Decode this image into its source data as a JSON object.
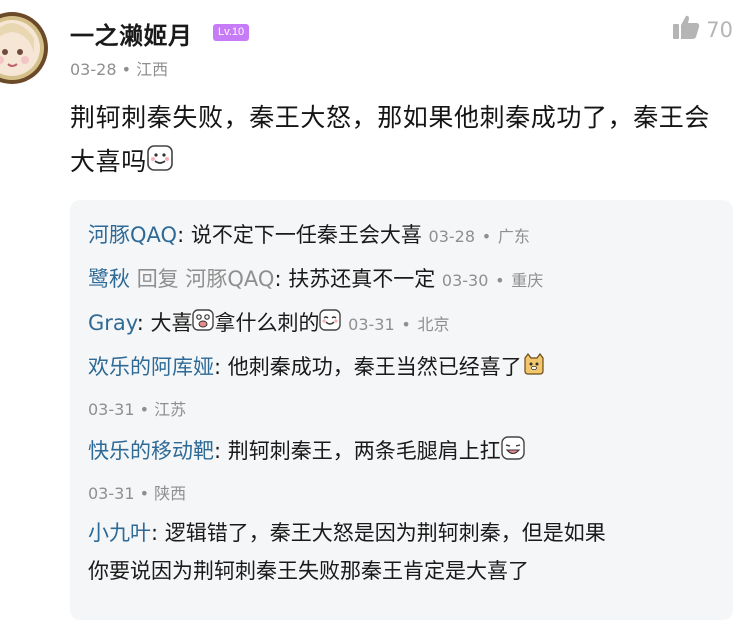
{
  "comment": {
    "username": "一之濑姬月",
    "level": "Lv.10",
    "like_count": "70",
    "date": "03-28",
    "location": "江西",
    "text": "荆轲刺秦失败，秦王大怒，那如果他刺秦成功了，秦王会大喜吗"
  },
  "replies": [
    {
      "name": "河豚QAQ",
      "text": "说不定下一任秦王会大喜",
      "date": "03-28",
      "location": "广东"
    },
    {
      "name": "鹭秋",
      "reply_word": "回复",
      "reply_to": "河豚QAQ",
      "text": "扶苏还真不一定",
      "date": "03-30",
      "location": "重庆"
    },
    {
      "name": "Gray",
      "text_a": "大喜",
      "text_b": "拿什么刺的",
      "date": "03-31",
      "location": "北京"
    },
    {
      "name": "欢乐的阿库娅",
      "text": "他刺秦成功，秦王当然已经喜了",
      "date": "03-31",
      "location": "江苏"
    },
    {
      "name": "快乐的移动靶",
      "text": "荆轲刺秦王，两条毛腿肩上扛",
      "date": "03-31",
      "location": "陕西"
    },
    {
      "name": "小九叶",
      "text_line1": "逻辑错了，秦王大怒是因为荆轲刺秦，但是如果",
      "text_line2": "你要说因为荆轲刺秦王失败那秦王肯定是大喜了"
    }
  ],
  "separator": "•",
  "colon": ":",
  "icons": {
    "like": "thumbs-up-icon",
    "avatar": "avatar"
  },
  "colors": {
    "name": "#2e6a96",
    "level_badge": "#c77cf7",
    "reply_bg": "#f5f6f8"
  }
}
